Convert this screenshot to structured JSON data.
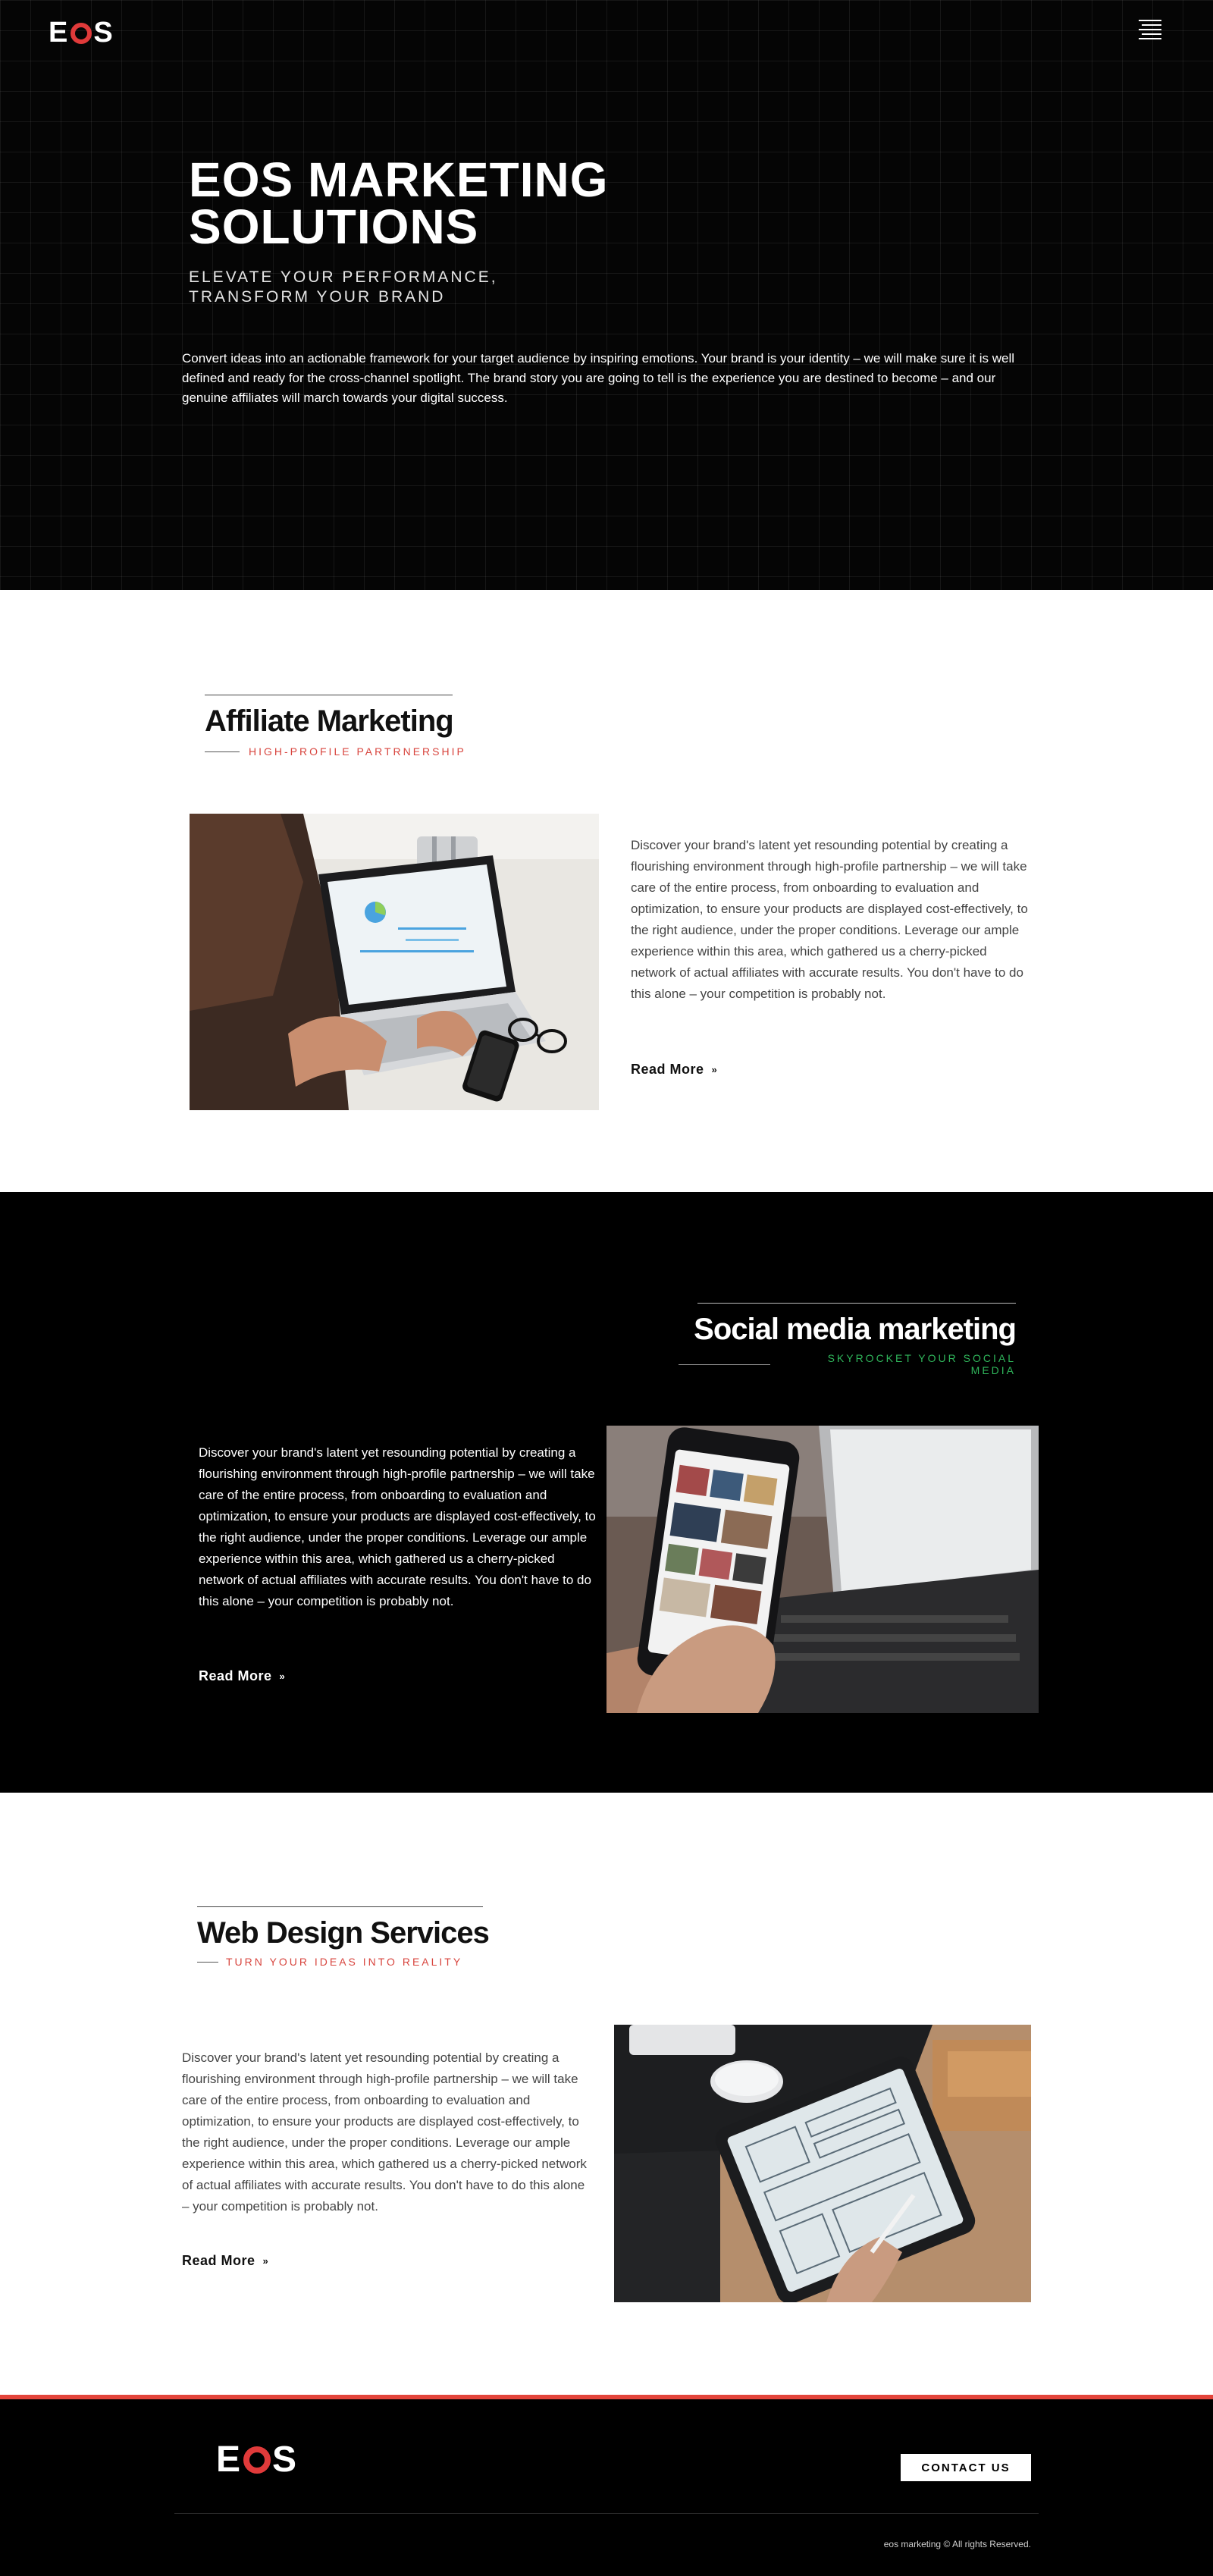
{
  "header": {
    "logo_left": "E",
    "logo_right": "S",
    "menu_icon": "hamburger-menu-icon"
  },
  "hero": {
    "title": "EOS MARKETING SOLUTIONS",
    "subtitle": "ELEVATE YOUR PERFORMANCE, TRANSFORM YOUR BRAND",
    "text": "Convert ideas into an actionable framework for your target audience by inspiring emotions. Your brand is your identity – we will make sure it is well defined and ready for the cross-channel spotlight. The brand story you are going to tell is the experience you are destined to become – and our genuine affiliates will march towards your digital success."
  },
  "sections": [
    {
      "title": "Affiliate Marketing",
      "tag": "HIGH-PROFILE PARTRNERSHIP",
      "tag_color": "#d8453e",
      "text": "Discover your brand's latent yet resounding potential by creating a flourishing environment through high-profile partnership – we will take care of the entire process, from onboarding to evaluation and optimization, to ensure your products are displayed cost-effectively, to the right audience, under the proper conditions. Leverage our ample experience within this area, which gathered us a cherry-picked network of actual affiliates with accurate results. You don't have to do this alone – your competition is probably not.",
      "read_more": "Read More",
      "image": "laptop-analytics-photo"
    },
    {
      "title": "Social media marketing",
      "tag": "SKYROCKET YOUR SOCIAL MEDIA",
      "tag_color": "#2fb45a",
      "text": "Discover your brand's latent yet resounding potential by creating a flourishing environment through high-profile partnership – we will take care of the entire process, from onboarding to evaluation and optimization, to ensure your products are displayed cost-effectively, to the right audience, under the proper conditions. Leverage our ample experience within this area, which gathered us a cherry-picked network of actual affiliates with accurate results. You don't have to do this alone – your competition is probably not.",
      "read_more": "Read More",
      "image": "smartphone-social-photo"
    },
    {
      "title": "Web Design Services",
      "tag": "TURN YOUR IDEAS INTO REALITY",
      "tag_color": "#d8453e",
      "text": "Discover your brand's latent yet resounding potential by creating a flourishing environment through high-profile partnership – we will take care of the entire process, from onboarding to evaluation and optimization, to ensure your products are displayed cost-effectively, to the right audience, under the proper conditions. Leverage our ample experience within this area, which gathered us a cherry-picked network of actual affiliates with accurate results. You don't have to do this alone – your competition is probably not.",
      "read_more": "Read More",
      "image": "tablet-wireframe-photo"
    }
  ],
  "footer": {
    "logo_left": "E",
    "logo_right": "S",
    "contact_label": "CONTACT US",
    "copyright": "eos marketing © All rights Reserved."
  },
  "colors": {
    "accent": "#e03a3a",
    "dark_bg": "#000000",
    "hero_bg": "#050505"
  }
}
